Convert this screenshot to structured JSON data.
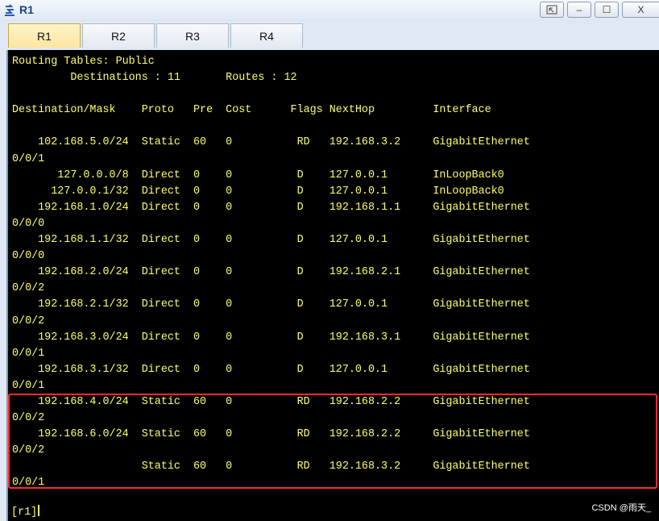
{
  "window": {
    "title": "R1"
  },
  "window_controls": {
    "minimize": "–",
    "maximize": "☐",
    "close": "X"
  },
  "tabs": [
    {
      "label": "R1"
    },
    {
      "label": "R2"
    },
    {
      "label": "R3"
    },
    {
      "label": "R4"
    }
  ],
  "routing": {
    "header1": "Routing Tables: Public",
    "destinations_label": "Destinations : 11",
    "routes_label": "Routes : 12",
    "columns": [
      "Destination/Mask",
      "Proto",
      "Pre",
      "Cost",
      "Flags",
      "NextHop",
      "Interface"
    ],
    "rows": [
      {
        "dest": "102.168.5.0/24",
        "proto": "Static",
        "pre": "60",
        "cost": "0",
        "flags": "RD",
        "nexthop": "192.168.3.2",
        "iface": "GigabitEthernet",
        "iface_cont": "0/0/1"
      },
      {
        "dest": "127.0.0.0/8",
        "proto": "Direct",
        "pre": "0",
        "cost": "0",
        "flags": "D",
        "nexthop": "127.0.0.1",
        "iface": "InLoopBack0",
        "iface_cont": ""
      },
      {
        "dest": "127.0.0.1/32",
        "proto": "Direct",
        "pre": "0",
        "cost": "0",
        "flags": "D",
        "nexthop": "127.0.0.1",
        "iface": "InLoopBack0",
        "iface_cont": ""
      },
      {
        "dest": "192.168.1.0/24",
        "proto": "Direct",
        "pre": "0",
        "cost": "0",
        "flags": "D",
        "nexthop": "192.168.1.1",
        "iface": "GigabitEthernet",
        "iface_cont": "0/0/0"
      },
      {
        "dest": "192.168.1.1/32",
        "proto": "Direct",
        "pre": "0",
        "cost": "0",
        "flags": "D",
        "nexthop": "127.0.0.1",
        "iface": "GigabitEthernet",
        "iface_cont": "0/0/0"
      },
      {
        "dest": "192.168.2.0/24",
        "proto": "Direct",
        "pre": "0",
        "cost": "0",
        "flags": "D",
        "nexthop": "192.168.2.1",
        "iface": "GigabitEthernet",
        "iface_cont": "0/0/2"
      },
      {
        "dest": "192.168.2.1/32",
        "proto": "Direct",
        "pre": "0",
        "cost": "0",
        "flags": "D",
        "nexthop": "127.0.0.1",
        "iface": "GigabitEthernet",
        "iface_cont": "0/0/2"
      },
      {
        "dest": "192.168.3.0/24",
        "proto": "Direct",
        "pre": "0",
        "cost": "0",
        "flags": "D",
        "nexthop": "192.168.3.1",
        "iface": "GigabitEthernet",
        "iface_cont": "0/0/1"
      },
      {
        "dest": "192.168.3.1/32",
        "proto": "Direct",
        "pre": "0",
        "cost": "0",
        "flags": "D",
        "nexthop": "127.0.0.1",
        "iface": "GigabitEthernet",
        "iface_cont": "0/0/1"
      },
      {
        "dest": "192.168.4.0/24",
        "proto": "Static",
        "pre": "60",
        "cost": "0",
        "flags": "RD",
        "nexthop": "192.168.2.2",
        "iface": "GigabitEthernet",
        "iface_cont": "0/0/2"
      },
      {
        "dest": "192.168.6.0/24",
        "proto": "Static",
        "pre": "60",
        "cost": "0",
        "flags": "RD",
        "nexthop": "192.168.2.2",
        "iface": "GigabitEthernet",
        "iface_cont": "0/0/2"
      },
      {
        "dest": "",
        "proto": "Static",
        "pre": "60",
        "cost": "0",
        "flags": "RD",
        "nexthop": "192.168.3.2",
        "iface": "GigabitEthernet",
        "iface_cont": "0/0/1"
      }
    ]
  },
  "prompt": "[r1]",
  "watermark": "CSDN @雨天_"
}
